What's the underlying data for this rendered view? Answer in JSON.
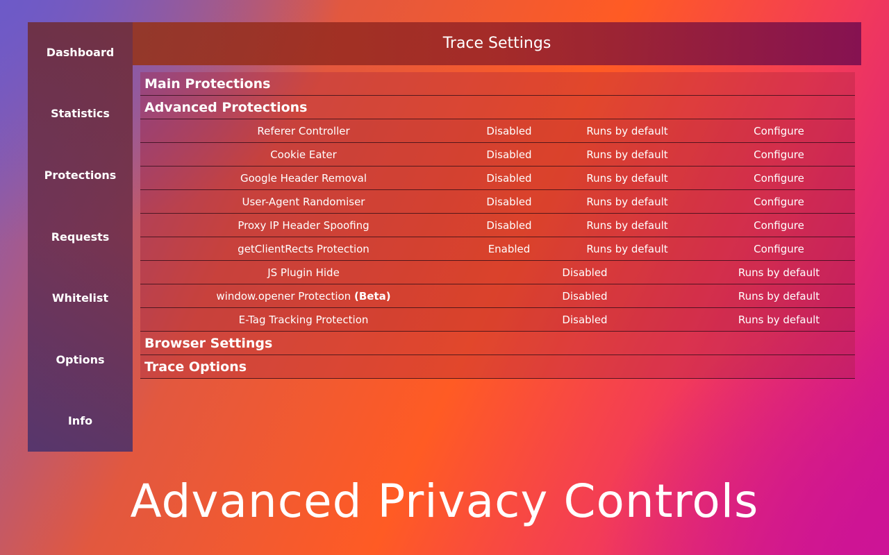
{
  "sidebar": {
    "items": [
      {
        "label": "Dashboard"
      },
      {
        "label": "Statistics"
      },
      {
        "label": "Protections"
      },
      {
        "label": "Requests"
      },
      {
        "label": "Whitelist"
      },
      {
        "label": "Options"
      },
      {
        "label": "Info"
      }
    ]
  },
  "header": {
    "title": "Trace Settings"
  },
  "sections": {
    "main": "Main Protections",
    "advanced": "Advanced Protections",
    "browser": "Browser Settings",
    "trace": "Trace Options"
  },
  "advanced_rows": [
    {
      "name": "Referer Controller",
      "status": "Disabled",
      "default": "Runs by default",
      "action": "Configure"
    },
    {
      "name": "Cookie Eater",
      "status": "Disabled",
      "default": "Runs by default",
      "action": "Configure"
    },
    {
      "name": "Google Header Removal",
      "status": "Disabled",
      "default": "Runs by default",
      "action": "Configure"
    },
    {
      "name": "User-Agent Randomiser",
      "status": "Disabled",
      "default": "Runs by default",
      "action": "Configure"
    },
    {
      "name": "Proxy IP Header Spoofing",
      "status": "Disabled",
      "default": "Runs by default",
      "action": "Configure"
    },
    {
      "name": "getClientRects Protection",
      "status": "Enabled",
      "default": "Runs by default",
      "action": "Configure"
    }
  ],
  "simple_rows": [
    {
      "name": "JS Plugin Hide",
      "name_suffix": "",
      "status": "Disabled",
      "default": "Runs by default"
    },
    {
      "name": "window.opener Protection",
      "name_suffix": "(Beta)",
      "status": "Disabled",
      "default": "Runs by default"
    },
    {
      "name": "E-Tag Tracking Protection",
      "name_suffix": "",
      "status": "Disabled",
      "default": "Runs by default"
    }
  ],
  "tagline": "Advanced Privacy Controls"
}
